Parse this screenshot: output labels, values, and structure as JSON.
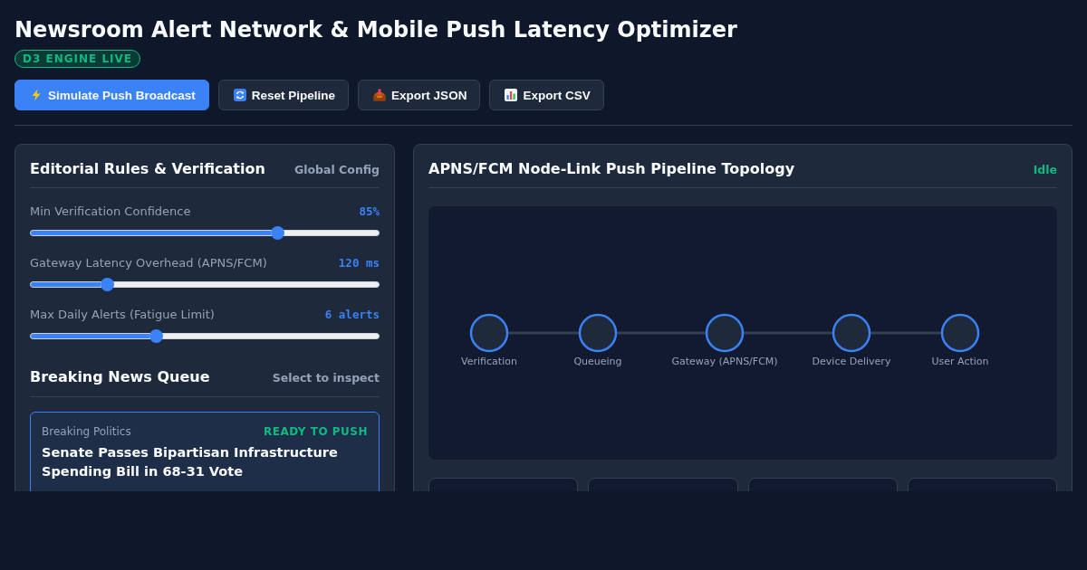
{
  "header": {
    "title": "Newsroom Alert Network & Mobile Push Latency Optimizer",
    "badge": "D3 ENGINE LIVE"
  },
  "toolbar": [
    {
      "label": "Simulate Push Broadcast",
      "kind": "primary"
    },
    {
      "label": "Reset Pipeline",
      "kind": "secondary"
    },
    {
      "label": "Export JSON",
      "kind": "secondary"
    },
    {
      "label": "Export CSV",
      "kind": "secondary"
    }
  ],
  "rules_panel": {
    "title": "Editorial Rules & Verification",
    "note": "Global Config",
    "sliders": [
      {
        "label": "Min Verification Confidence",
        "reading": "85%",
        "level": 0.71
      },
      {
        "label": "Gateway Latency Overhead (APNS/FCM)",
        "reading": "120 ms",
        "level": 0.22
      },
      {
        "label": "Max Daily Alerts (Fatigue Limit)",
        "reading": "6 alerts",
        "level": 0.36
      }
    ]
  },
  "queue": {
    "title": "Breaking News Queue",
    "note": "Select to inspect",
    "items": [
      {
        "category": "Breaking Politics",
        "status": "READY TO PUSH",
        "headline": "Senate Passes Bipartisan Infrastructure Spending Bill in 68-31 Vote",
        "selected": true
      }
    ]
  },
  "topology_panel": {
    "title": "APNS/FCM Node-Link Push Pipeline Topology",
    "status": "Idle",
    "nodes": [
      {
        "label": "Verification"
      },
      {
        "label": "Queueing"
      },
      {
        "label": "Gateway (APNS/FCM)"
      },
      {
        "label": "Device Delivery"
      },
      {
        "label": "User Action"
      }
    ]
  }
}
